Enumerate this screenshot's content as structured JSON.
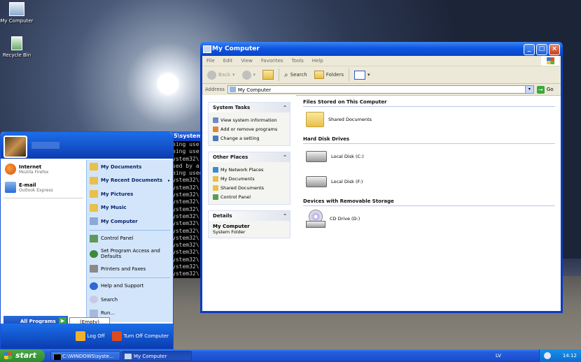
{
  "desktop": {
    "icons": [
      {
        "label": "My Computer",
        "icon": "my-computer-icon"
      },
      {
        "label": "Recycle Bin",
        "icon": "recycle-bin-icon"
      }
    ]
  },
  "console": {
    "title": "5\\system3",
    "lines": [
      "eing use",
      "eing use",
      "ystem32\\",
      "sed by a",
      "eing used",
      "ystem32\\",
      "ystem32\\",
      "ystem32\\",
      "ystem32\\",
      "ystem32\\",
      "ystem32\\",
      "ystem32\\",
      "ystem32\\",
      "ystem32\\",
      "ystem32\\",
      "ystem32\\",
      "ystem32\\",
      "ystem32\\",
      "ystem32\\"
    ]
  },
  "explorer": {
    "title": "My Computer",
    "menu": [
      "File",
      "Edit",
      "View",
      "Favorites",
      "Tools",
      "Help"
    ],
    "toolbar": {
      "back": "Back",
      "search": "Search",
      "folders": "Folders"
    },
    "address": {
      "label": "Address",
      "value": "My Computer",
      "go": "Go"
    },
    "system_tasks": {
      "title": "System Tasks",
      "items": [
        "View system information",
        "Add or remove programs",
        "Change a setting"
      ]
    },
    "other_places": {
      "title": "Other Places",
      "items": [
        "My Network Places",
        "My Documents",
        "Shared Documents",
        "Control Panel"
      ]
    },
    "details": {
      "title": "Details",
      "name": "My Computer",
      "type": "System Folder"
    },
    "groups": {
      "stored": {
        "title": "Files Stored on This Computer",
        "items": [
          "Shared Documents"
        ]
      },
      "hdd": {
        "title": "Hard Disk Drives",
        "items": [
          "Local Disk (C:)",
          "Local Disk (F:)"
        ]
      },
      "removable": {
        "title": "Devices with Removable Storage",
        "items": [
          "CD Drive (D:)"
        ]
      }
    }
  },
  "startmenu": {
    "pinned": [
      {
        "title": "Internet",
        "sub": "Mozilla Firefox"
      },
      {
        "title": "E-mail",
        "sub": "Outlook Express"
      }
    ],
    "right_items": [
      {
        "label": "My Documents",
        "bold": true
      },
      {
        "label": "My Recent Documents",
        "bold": true,
        "arrow": "▸"
      },
      {
        "label": "My Pictures",
        "bold": true
      },
      {
        "label": "My Music",
        "bold": true
      },
      {
        "label": "My Computer",
        "bold": true
      },
      {
        "label": "Control Panel",
        "bold": false
      },
      {
        "label": "Set Program Access and Defaults",
        "bold": false
      },
      {
        "label": "Printers and Faxes",
        "bold": false
      },
      {
        "label": "Help and Support",
        "bold": false
      },
      {
        "label": "Search",
        "bold": false
      },
      {
        "label": "Run...",
        "bold": false
      }
    ],
    "all_programs": "All Programs",
    "empty": "(Empty)",
    "log_off": "Log Off",
    "turn_off": "Turn Off Computer"
  },
  "taskbar": {
    "start": "start",
    "tasks": [
      "C:\\WINDOWS\\syste...",
      "My Computer"
    ],
    "lang": "LV",
    "clock": "14:12"
  },
  "colors": {
    "xp_blue": "#0a3cbf",
    "start_green": "#2e8a2e",
    "panel_blue": "#d3e5fa"
  }
}
